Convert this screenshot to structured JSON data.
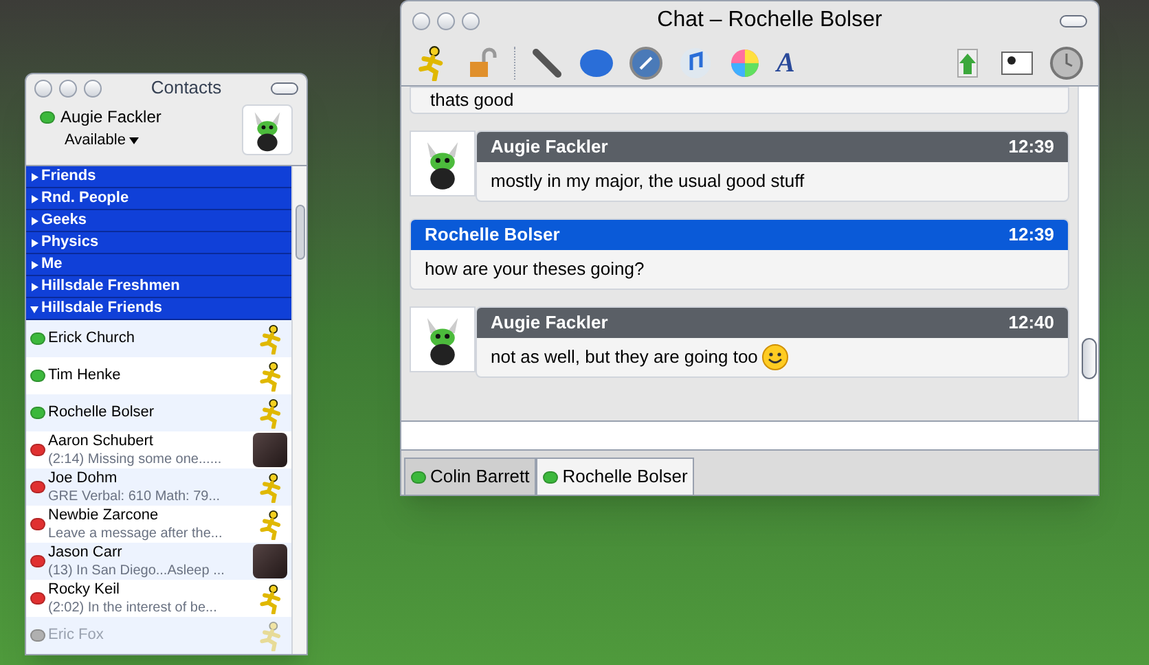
{
  "contacts_window": {
    "title": "Contacts",
    "user": {
      "name": "Augie Fackler",
      "status": "Available",
      "color": "#3cb83c"
    },
    "groups": [
      {
        "name": "Friends",
        "expanded": false
      },
      {
        "name": "Rnd. People",
        "expanded": false
      },
      {
        "name": "Geeks",
        "expanded": false
      },
      {
        "name": "Physics",
        "expanded": false
      },
      {
        "name": "Me",
        "expanded": false
      },
      {
        "name": "Hillsdale Freshmen",
        "expanded": false
      },
      {
        "name": "Hillsdale Friends",
        "expanded": true,
        "contacts": [
          {
            "name": "Erick Church",
            "color": "#3cb83c",
            "kind": "aim"
          },
          {
            "name": "Tim Henke",
            "color": "#3cb83c",
            "kind": "aim"
          },
          {
            "name": "Rochelle Bolser",
            "color": "#3cb83c",
            "kind": "aim"
          },
          {
            "name": "Aaron Schubert",
            "message": "(2:14) Missing some one......",
            "color": "#e03030",
            "kind": "photo"
          },
          {
            "name": "Joe Dohm",
            "message": "GRE Verbal: 610 Math: 79...",
            "color": "#e03030",
            "kind": "aim"
          },
          {
            "name": "Newbie Zarcone",
            "message": "Leave a message after the...",
            "color": "#e03030",
            "kind": "aim"
          },
          {
            "name": "Jason Carr",
            "message": "(13) In San Diego...Asleep ...",
            "color": "#e03030",
            "kind": "photo"
          },
          {
            "name": "Rocky Keil",
            "message": "(2:02) In the interest of be...",
            "color": "#e03030",
            "kind": "aim"
          },
          {
            "name": "Eric Fox",
            "color": "#b0b0b0",
            "kind": "aim",
            "offline": true
          }
        ]
      }
    ]
  },
  "chat_window": {
    "title": "Chat – Rochelle Bolser",
    "font_button": "A",
    "messages": [
      {
        "kind": "partial",
        "text": "thats good"
      },
      {
        "kind": "self",
        "sender": "Augie Fackler",
        "time": "12:39",
        "text": "mostly in my major, the usual good stuff"
      },
      {
        "kind": "other",
        "sender": "Rochelle Bolser",
        "time": "12:39",
        "text": "how are your theses going?"
      },
      {
        "kind": "self",
        "sender": "Augie Fackler",
        "time": "12:40",
        "text": "not as well, but they are going too",
        "emoticon": true
      }
    ],
    "tabs": [
      {
        "label": "Colin Barrett",
        "selected": false,
        "color": "#3cb83c"
      },
      {
        "label": "Rochelle Bolser",
        "selected": true,
        "color": "#3cb83c"
      }
    ]
  }
}
